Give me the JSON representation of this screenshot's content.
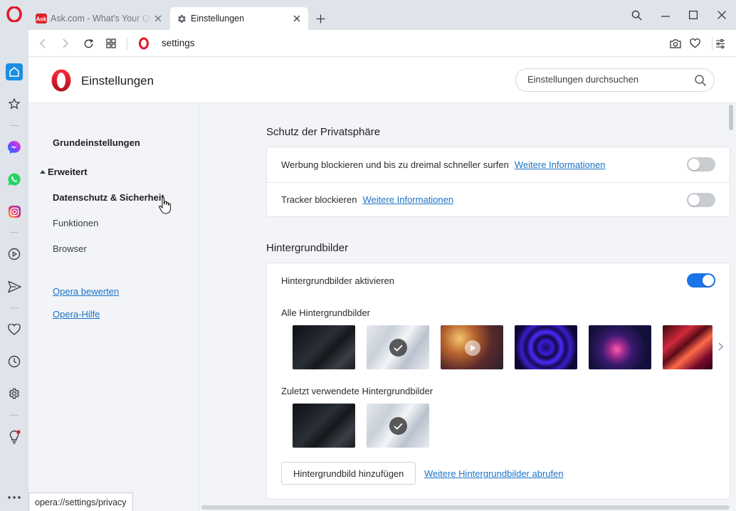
{
  "tabs": [
    {
      "title": "Ask.com - What's Your Question?",
      "favicon": "ask-favicon",
      "close_icon": "close-icon"
    },
    {
      "title": "Einstellungen",
      "favicon": "gear-icon",
      "close_icon": "close-icon"
    }
  ],
  "address_bar": {
    "url": "settings"
  },
  "header": {
    "title": "Einstellungen",
    "search_placeholder": "Einstellungen durchsuchen"
  },
  "nav": {
    "basic": "Grundeinstellungen",
    "advanced": "Erweitert",
    "privacy": "Datenschutz & Sicherheit",
    "features": "Funktionen",
    "browser": "Browser",
    "rate": "Opera bewerten",
    "help": "Opera-Hilfe"
  },
  "privacy_section": {
    "title": "Schutz der Privatsphäre",
    "rows": [
      {
        "label": "Werbung blockieren und bis zu dreimal schneller surfen",
        "link": "Weitere Informationen",
        "enabled": false
      },
      {
        "label": "Tracker blockieren",
        "link": "Weitere Informationen",
        "enabled": false
      }
    ]
  },
  "wallpaper_section": {
    "title": "Hintergrundbilder",
    "enable_label": "Hintergrundbilder aktivieren",
    "enabled": true,
    "all_label": "Alle Hintergrundbilder",
    "recent_label": "Zuletzt verwendete Hintergrundbilder",
    "add_button": "Hintergrundbild hinzufügen",
    "more_link": "Weitere Hintergrundbilder abrufen"
  },
  "status_bar": {
    "url": "opera://settings/privacy"
  },
  "colors": {
    "accent": "#1a73e8",
    "link": "#1a73c7",
    "opera_red": "#e21a2c",
    "sidebar_bg": "#dfe3ea"
  }
}
